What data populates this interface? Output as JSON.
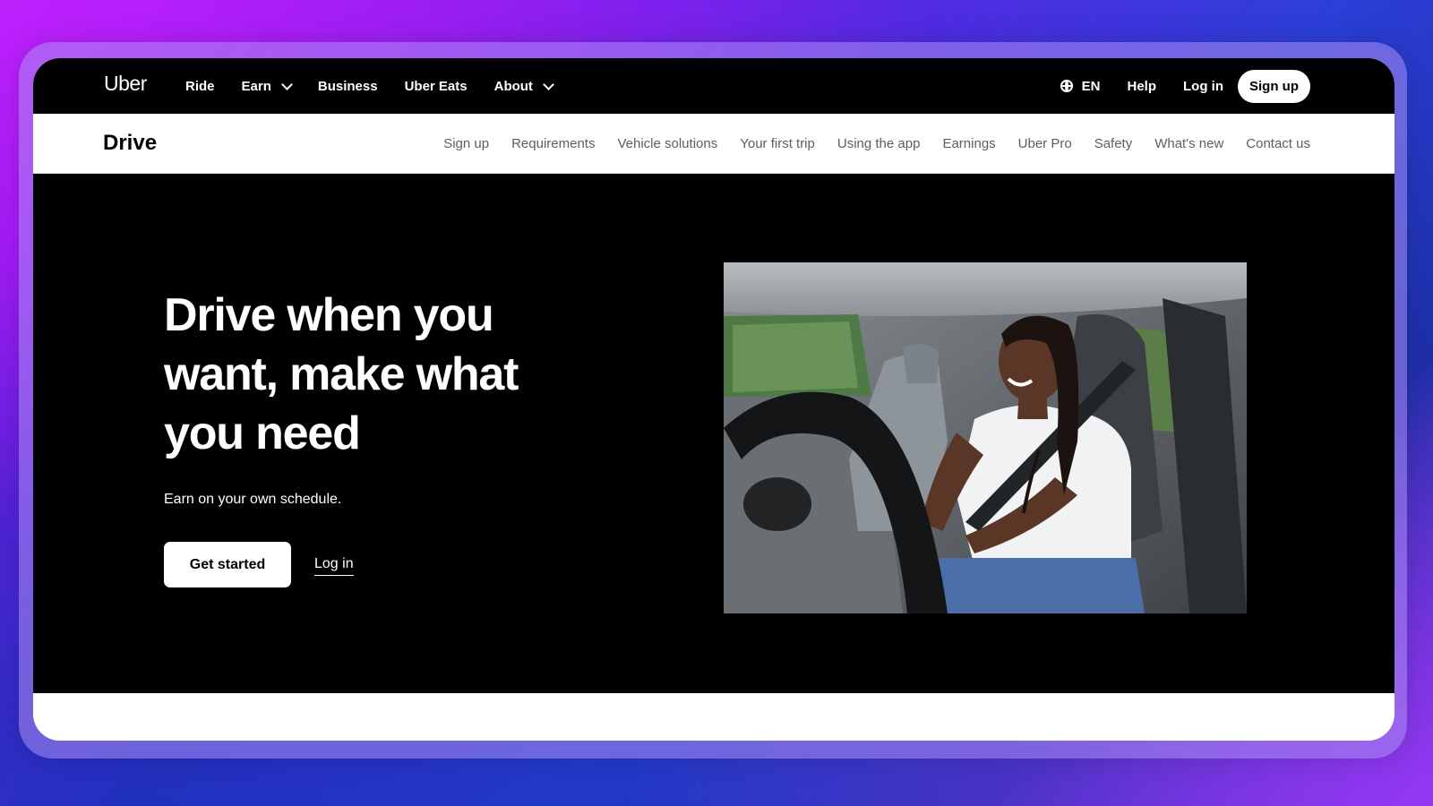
{
  "topnav": {
    "logo": "Uber",
    "items": [
      {
        "label": "Ride",
        "dropdown": false
      },
      {
        "label": "Earn",
        "dropdown": true
      },
      {
        "label": "Business",
        "dropdown": false
      },
      {
        "label": "Uber Eats",
        "dropdown": false
      },
      {
        "label": "About",
        "dropdown": true
      }
    ],
    "language": "EN",
    "help": "Help",
    "login": "Log in",
    "signup": "Sign up"
  },
  "subnav": {
    "title": "Drive",
    "links": [
      "Sign up",
      "Requirements",
      "Vehicle solutions",
      "Your first trip",
      "Using the app",
      "Earnings",
      "Uber Pro",
      "Safety",
      "What's new",
      "Contact us"
    ]
  },
  "hero": {
    "headline": "Drive when you want, make what you need",
    "subtext": "Earn on your own schedule.",
    "primary_button": "Get started",
    "secondary_link": "Log in"
  },
  "colors": {
    "nav_bg": "#000000",
    "hero_bg": "#000000",
    "subnav_link": "#5e5e5e",
    "button_bg": "#ffffff"
  },
  "icons": {
    "language": "globe-icon",
    "dropdown": "chevron-down-icon"
  }
}
